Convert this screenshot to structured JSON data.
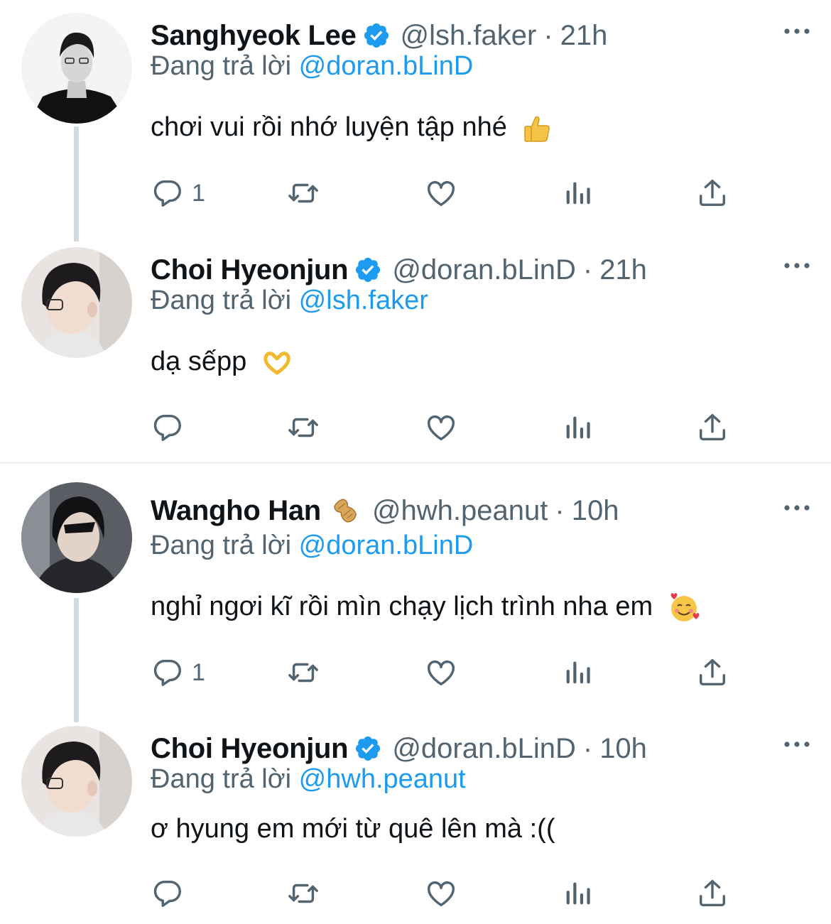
{
  "tweets": [
    {
      "name": "Sanghyeok Lee",
      "handle": "@lsh.faker",
      "sep": "·",
      "time": "21h",
      "replying_prefix": "Đang trả lời ",
      "replying_to": "@doran.bLinD",
      "text": "chơi vui rồi nhớ luyện tập nhé",
      "emoji": "thumbs-up",
      "reply_count": "1"
    },
    {
      "name": "Choi Hyeonjun",
      "handle": "@doran.bLinD",
      "sep": "·",
      "time": "21h",
      "replying_prefix": "Đang trả lời ",
      "replying_to": "@lsh.faker",
      "text": "dạ sếpp",
      "emoji": "heart-hands",
      "reply_count": ""
    },
    {
      "name": "Wangho Han",
      "handle": "@hwh.peanut",
      "sep": "·",
      "time": "10h",
      "replying_prefix": "Đang trả lời ",
      "replying_to": "@doran.bLinD",
      "text": "nghỉ ngơi kĩ rồi mìn chạy lịch trình nha em",
      "emoji": "smiling-face-with-hearts",
      "reply_count": "1"
    },
    {
      "name": "Choi Hyeonjun",
      "handle": "@doran.bLinD",
      "sep": "·",
      "time": "10h",
      "replying_prefix": "Đang trả lời ",
      "replying_to": "@hwh.peanut",
      "text": "ơ hyung em mới từ quê lên mà :((",
      "emoji": "",
      "reply_count": ""
    }
  ],
  "colors": {
    "accent": "#1d9bf0",
    "secondary_text": "#536471",
    "thread_line": "#cfd9de",
    "divider": "#eff3f4"
  },
  "icons": [
    "verified-badge-icon",
    "more-options-icon",
    "reply-icon",
    "retweet-icon",
    "like-icon",
    "analytics-icon",
    "share-icon",
    "peanut-emoji-icon"
  ]
}
